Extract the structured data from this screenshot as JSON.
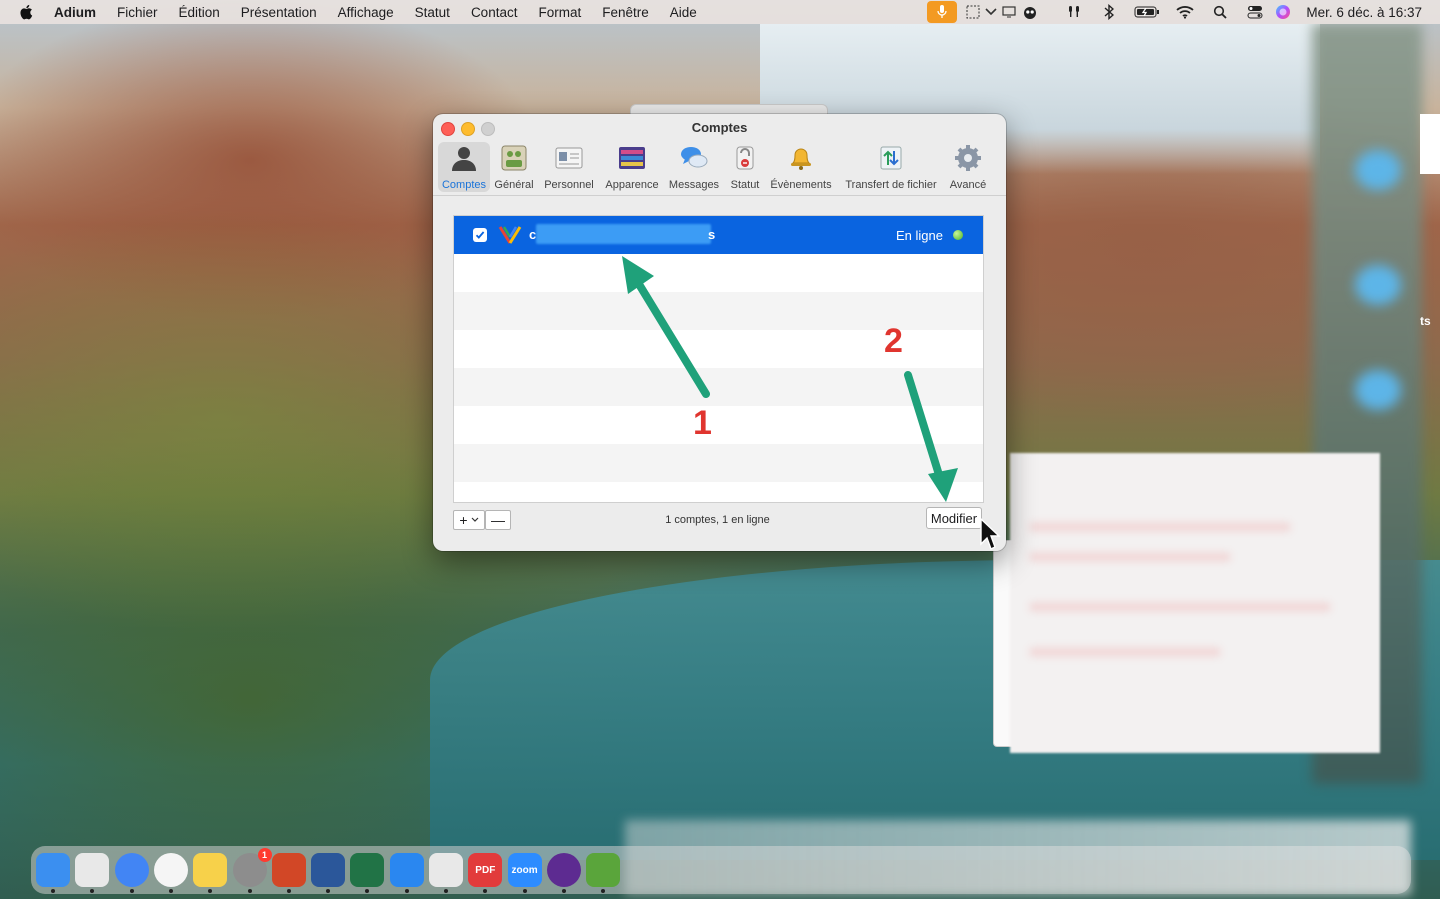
{
  "menubar": {
    "app_name": "Adium",
    "items": [
      "Fichier",
      "Édition",
      "Présentation",
      "Affichage",
      "Statut",
      "Contact",
      "Format",
      "Fenêtre",
      "Aide"
    ],
    "clock": "Mer. 6 déc. à 16:37",
    "status_icons": [
      "microphone-icon",
      "screen-capture-icon",
      "chevron-down-icon",
      "display-icon",
      "owl-icon",
      "airpods-icon",
      "bluetooth-icon",
      "battery-icon",
      "wifi-icon",
      "search-icon",
      "control-center-icon",
      "siri-icon"
    ]
  },
  "window": {
    "title": "Comptes",
    "toolbar": [
      {
        "id": "comptes",
        "label": "Comptes",
        "icon": "accounts-icon",
        "selected": true
      },
      {
        "id": "general",
        "label": "Général",
        "icon": "general-icon"
      },
      {
        "id": "personnel",
        "label": "Personnel",
        "icon": "personal-card-icon"
      },
      {
        "id": "apparence",
        "label": "Apparence",
        "icon": "appearance-icon"
      },
      {
        "id": "messages",
        "label": "Messages",
        "icon": "messages-icon"
      },
      {
        "id": "statut",
        "label": "Statut",
        "icon": "status-lock-icon"
      },
      {
        "id": "evenements",
        "label": "Évènements",
        "icon": "bell-icon"
      },
      {
        "id": "transfert",
        "label": "Transfert de fichier",
        "icon": "file-transfer-icon"
      },
      {
        "id": "avance",
        "label": "Avancé",
        "icon": "gear-icon"
      }
    ],
    "accounts": [
      {
        "name_visible_start": "c",
        "name_visible_end": "s",
        "status": "En ligne",
        "enabled": true,
        "service_icon": "google-talk-icon"
      }
    ],
    "summary": "1 comptes, 1 en ligne",
    "buttons": {
      "add": "+",
      "remove": "—",
      "modify": "Modifier"
    }
  },
  "annotations": {
    "step1": "1",
    "step2": "2",
    "arrow_color": "#1fa17a",
    "number_color": "#e0352f"
  },
  "desktop": {
    "side_text": "ts"
  },
  "dock": {
    "apps": [
      {
        "name": "finder-icon",
        "color": "#3b8ff0"
      },
      {
        "name": "launchpad-icon",
        "color": "#e8e8e8"
      },
      {
        "name": "chrome-icon",
        "color": "#4285f4"
      },
      {
        "name": "photos-icon",
        "color": "#f5f5f5"
      },
      {
        "name": "notes-icon",
        "color": "#f7d14a"
      },
      {
        "name": "system-settings-icon",
        "color": "#8d8d8d",
        "badge": "1"
      },
      {
        "name": "powerpoint-icon",
        "color": "#d24726"
      },
      {
        "name": "word-icon",
        "color": "#2b579a"
      },
      {
        "name": "excel-icon",
        "color": "#217346"
      },
      {
        "name": "bluetooth-app-icon",
        "color": "#2a87f0"
      },
      {
        "name": "accessibility-app-icon",
        "color": "#e8e8e8"
      },
      {
        "name": "pdf-expert-icon",
        "color": "#e23b3b",
        "label": "PDF"
      },
      {
        "name": "zoom-icon",
        "color": "#2d8cff",
        "label": "zoom"
      },
      {
        "name": "firefox-icon",
        "color": "#5d2b91"
      },
      {
        "name": "adium-duck-icon",
        "color": "#5aa53b"
      }
    ]
  }
}
